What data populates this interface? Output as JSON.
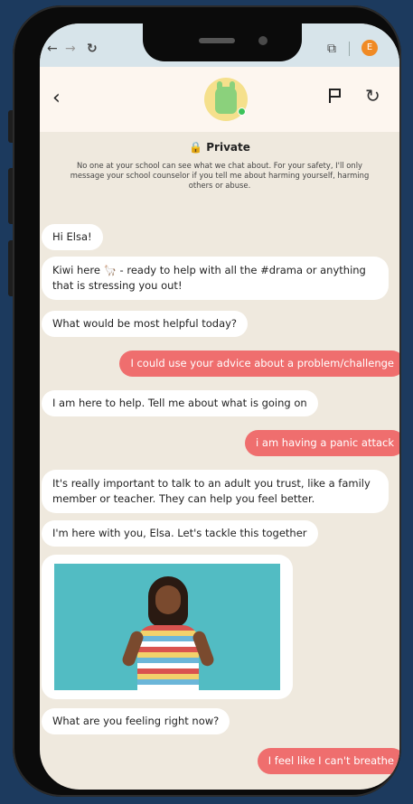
{
  "browser": {
    "account_initial": "E"
  },
  "header": {
    "mascot": "llama-icon"
  },
  "privacy": {
    "title": "Private",
    "body": "No one at your school can see what we chat about. For your safety, I'll only message your school counselor if you tell me about harming yourself, harming others or abuse."
  },
  "messages": [
    {
      "from": "bot",
      "text": "Hi Elsa!"
    },
    {
      "from": "bot",
      "text": "Kiwi here 🦙 - ready to help with all the #drama or anything that is stressing you out!"
    },
    {
      "from": "bot",
      "text": "What would be most helpful today?"
    },
    {
      "from": "user",
      "text": "I could use your advice about a problem/challenge"
    },
    {
      "from": "bot",
      "text": "I am here to help. Tell me about what is going on"
    },
    {
      "from": "user",
      "text": "i am having a panic attack"
    },
    {
      "from": "bot",
      "text": "It's really important to talk to an adult you trust, like a family member or teacher. They can help you feel better."
    },
    {
      "from": "bot",
      "text": "I'm here with you, Elsa. Let's tackle this together"
    },
    {
      "from": "bot",
      "text": "What are you feeling right now?"
    },
    {
      "from": "user",
      "text": "I feel like I can't breathe"
    }
  ],
  "colors": {
    "user_bubble": "#ef6e6e",
    "bot_bubble": "#ffffff",
    "chat_bg": "#efe9de"
  }
}
